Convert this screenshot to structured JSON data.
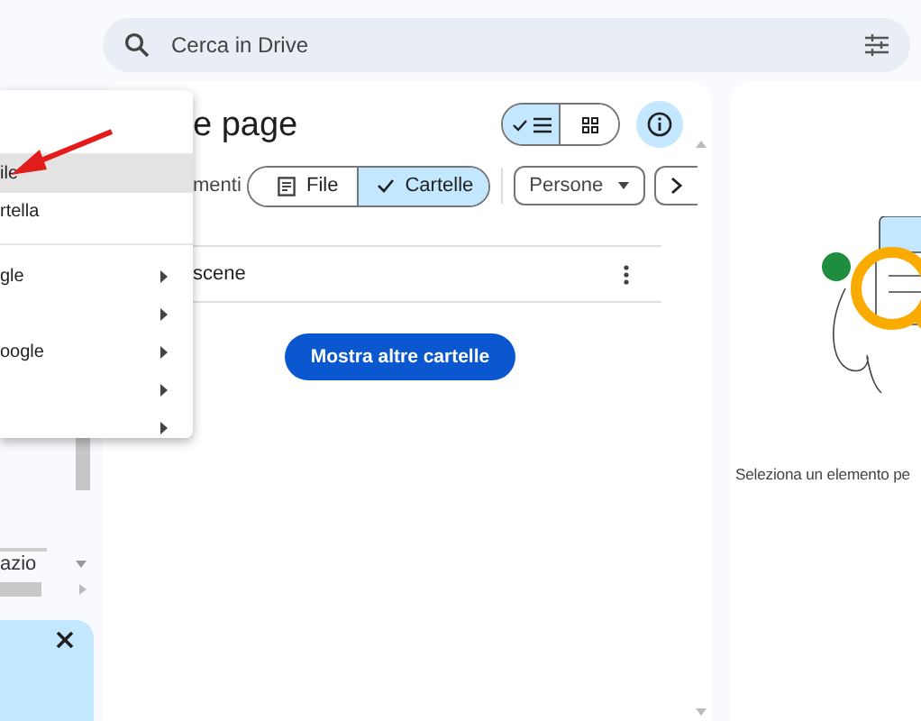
{
  "search": {
    "placeholder": "Cerca in Drive"
  },
  "sidebar": {
    "storage_label": "azio"
  },
  "menu": {
    "groups": [
      [
        {
          "label": "ile",
          "selected": true,
          "submenu": false
        },
        {
          "label": "rtella",
          "selected": false,
          "submenu": false
        }
      ],
      [
        {
          "label": "gle",
          "selected": false,
          "submenu": true
        },
        {
          "selected": false,
          "submenu": true
        },
        {
          "label": "oogle",
          "selected": false,
          "submenu": true
        },
        {
          "selected": false,
          "submenu": true
        },
        {
          "selected": false,
          "submenu": true
        }
      ]
    ]
  },
  "main": {
    "title": "e page",
    "view_toggle": [
      {
        "kind": "list",
        "selected": true
      },
      {
        "kind": "grid",
        "selected": false
      }
    ],
    "filter_label": "menti",
    "chips": [
      {
        "label": "File",
        "selected": false
      },
      {
        "label": "Cartelle",
        "selected": true
      }
    ],
    "dropdowns": [
      {
        "label": "Persone"
      }
    ],
    "rows": [
      {
        "name": "scene"
      }
    ],
    "more_button": "Mostra altre cartelle"
  },
  "details": {
    "message": "Seleziona un elemento pe"
  }
}
